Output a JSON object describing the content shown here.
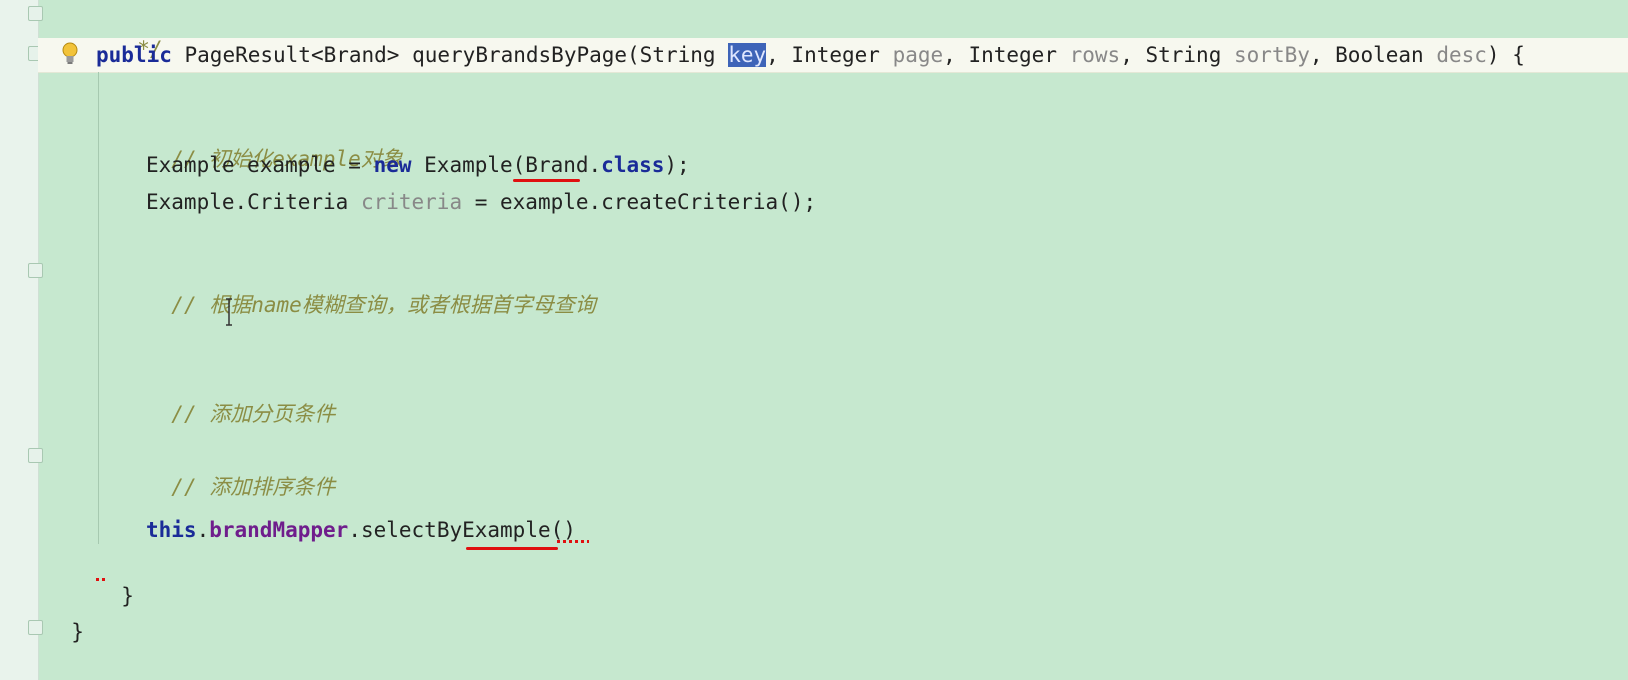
{
  "editor": {
    "lines": {
      "doc_end": "*/",
      "sig_kw": "public",
      "sig_type": "PageResult<Brand>",
      "sig_name": "queryBrandsByPage(String",
      "sig_key": "key",
      "sig_rest1": ", Integer",
      "sig_page": "page",
      "sig_rest2": ", Integer",
      "sig_rows": "rows",
      "sig_rest3": ", String",
      "sig_sortby": "sortBy",
      "sig_rest4": ", Boolean",
      "sig_desc": "desc",
      "sig_end": ") {",
      "comment_init": "// 初始化example对象",
      "ex_part1": "Example example = ",
      "ex_new": "new",
      "ex_part2": " Example(Brand.",
      "ex_class": "class",
      "ex_part3": ");",
      "crit_part1": "Example.Criteria ",
      "crit_var": "criteria",
      "crit_part2": " = example.createCriteria();",
      "comment_query": "// 根据name模糊查询，或者根据首字母查询",
      "comment_paging": "// 添加分页条件",
      "comment_sort": "// 添加排序条件",
      "call_this": "this",
      "call_dot": ".",
      "call_field": "brandMapper",
      "call_rest": ".selectByExample()",
      "close_method": "}",
      "close_class": "}"
    }
  }
}
